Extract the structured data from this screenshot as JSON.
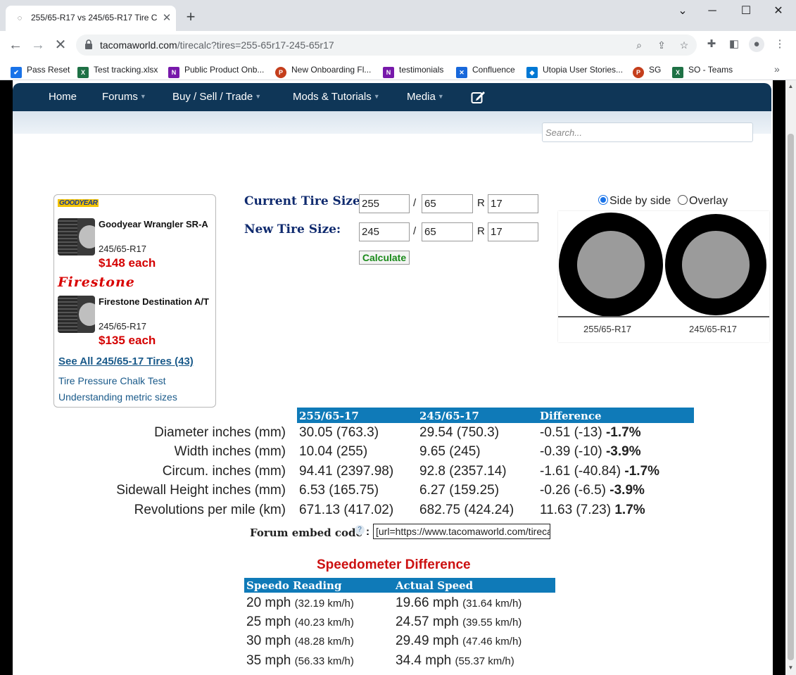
{
  "browser": {
    "tab_title": "255/65-R17 vs 245/65-R17 Tire C",
    "url_host": "tacomaworld.com",
    "url_path": "/tirecalc?tires=255-65r17-245-65r17",
    "bookmarks": [
      {
        "label": "Pass Reset",
        "icon": "pass-reset-icon",
        "color": "#1a73e8"
      },
      {
        "label": "Test tracking.xlsx",
        "icon": "excel-icon",
        "color": "#1e7145"
      },
      {
        "label": "Public Product Onb...",
        "icon": "onenote-icon",
        "color": "#7719aa"
      },
      {
        "label": "New Onboarding Fl...",
        "icon": "powerpoint-icon",
        "color": "#c43e1c"
      },
      {
        "label": "testimonials",
        "icon": "onenote-icon",
        "color": "#7719aa"
      },
      {
        "label": "Confluence",
        "icon": "confluence-icon",
        "color": "#1868db"
      },
      {
        "label": "Utopia User Stories...",
        "icon": "azure-devops-icon",
        "color": "#0078d4"
      },
      {
        "label": "SG",
        "icon": "powerpoint-icon",
        "color": "#c43e1c"
      },
      {
        "label": "SO - Teams",
        "icon": "excel-icon",
        "color": "#1e7145"
      }
    ]
  },
  "site": {
    "nav": [
      "Home",
      "Forums",
      "Buy / Sell / Trade",
      "Mods & Tutorials",
      "Media"
    ],
    "search_placeholder": "Search..."
  },
  "ads": {
    "items": [
      {
        "brand": "GOODYEAR",
        "name": "Goodyear Wrangler SR-A",
        "size": "245/65-R17",
        "price": "$148 each"
      },
      {
        "brand": "Firestone",
        "name": "Firestone Destination A/T",
        "size": "245/65-R17",
        "price": "$135 each"
      }
    ],
    "see_all": "See All 245/65-17 Tires (43)",
    "links": [
      "Tire Pressure Chalk Test",
      "Understanding metric sizes"
    ]
  },
  "form": {
    "current_label": "Current Tire Size:",
    "new_label": "New Tire Size:",
    "current": {
      "width": "255",
      "ratio": "65",
      "rim": "17"
    },
    "new": {
      "width": "245",
      "ratio": "65",
      "rim": "17"
    },
    "slash": "/",
    "r": "R",
    "calculate": "Calculate"
  },
  "visual": {
    "side_by_side": "Side by side",
    "overlay": "Overlay",
    "label_current": "255/65-R17",
    "label_new": "245/65-R17"
  },
  "comparison": {
    "headers": [
      "255/65-17",
      "245/65-17",
      "Difference"
    ],
    "rows": [
      {
        "label": "Diameter inches (mm)",
        "a": "30.05 (763.3)",
        "b": "29.54 (750.3)",
        "diff": "-0.51 (-13)",
        "pct": "-1.7%"
      },
      {
        "label": "Width inches (mm)",
        "a": "10.04 (255)",
        "b": "9.65 (245)",
        "diff": "-0.39 (-10)",
        "pct": "-3.9%"
      },
      {
        "label": "Circum. inches (mm)",
        "a": "94.41 (2397.98)",
        "b": "92.8 (2357.14)",
        "diff": "-1.61 (-40.84)",
        "pct": "-1.7%"
      },
      {
        "label": "Sidewall Height inches (mm)",
        "a": "6.53 (165.75)",
        "b": "6.27 (159.25)",
        "diff": "-0.26 (-6.5)",
        "pct": "-3.9%"
      },
      {
        "label": "Revolutions per mile (km)",
        "a": "671.13 (417.02)",
        "b": "682.75 (424.24)",
        "diff": "11.63 (7.23)",
        "pct": "1.7%"
      }
    ],
    "embed_label": "Forum embed code",
    "embed_help": "?",
    "embed_colon": ":",
    "embed_value": "[url=https://www.tacomaworld.com/tirecalc"
  },
  "speedo": {
    "title": "Speedometer Difference",
    "headers": [
      "Speedo Reading",
      "Actual Speed"
    ],
    "rows": [
      {
        "reading": "20 mph",
        "reading_kmh": "(32.19 km/h)",
        "actual": "19.66 mph",
        "actual_kmh": "(31.64 km/h)"
      },
      {
        "reading": "25 mph",
        "reading_kmh": "(40.23 km/h)",
        "actual": "24.57 mph",
        "actual_kmh": "(39.55 km/h)"
      },
      {
        "reading": "30 mph",
        "reading_kmh": "(48.28 km/h)",
        "actual": "29.49 mph",
        "actual_kmh": "(47.46 km/h)"
      },
      {
        "reading": "35 mph",
        "reading_kmh": "(56.33 km/h)",
        "actual": "34.4 mph",
        "actual_kmh": "(55.37 km/h)"
      }
    ]
  }
}
